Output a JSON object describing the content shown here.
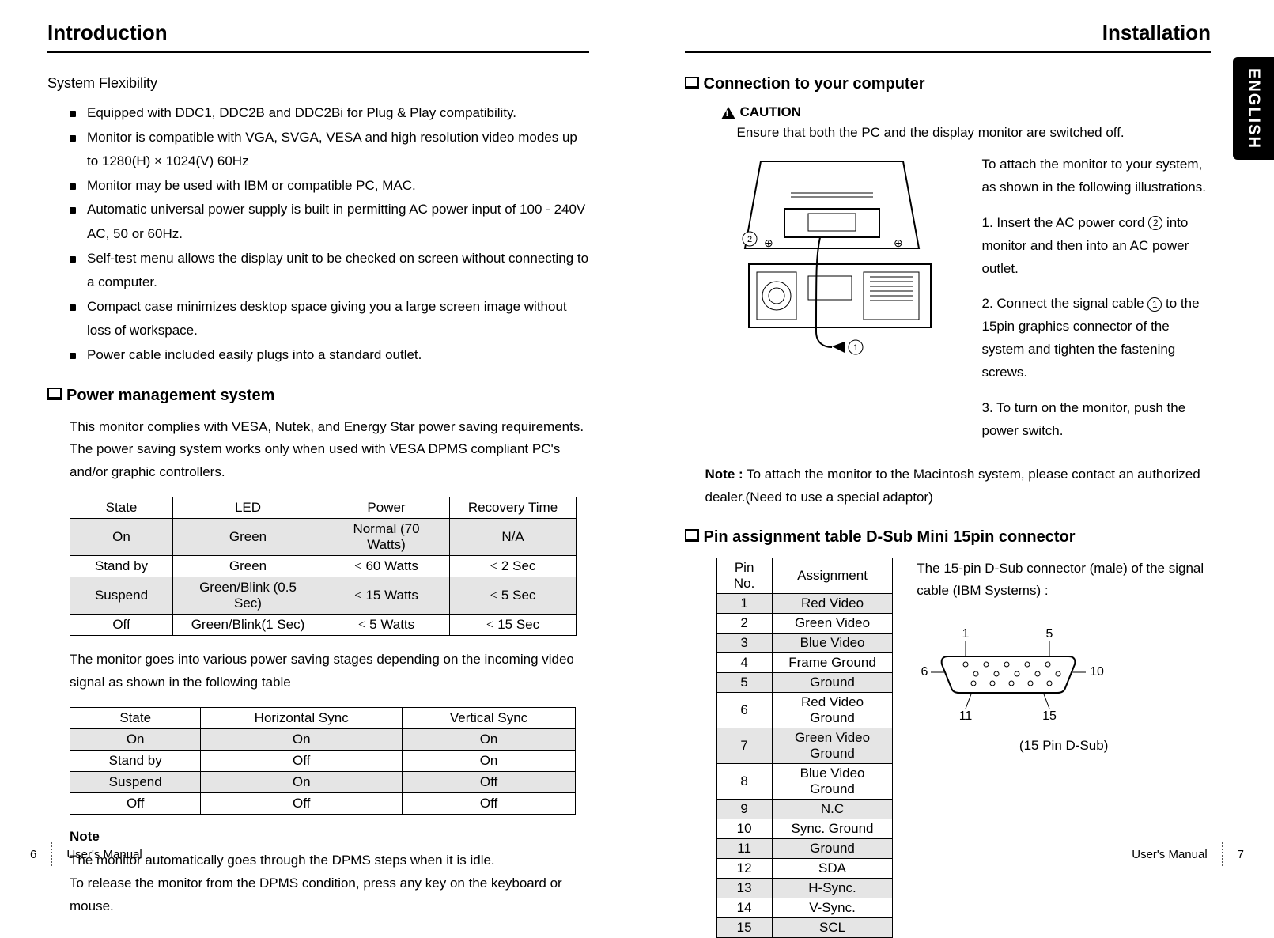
{
  "left": {
    "title": "Introduction",
    "sys_flex_heading": "System Flexibility",
    "flex_items": [
      "Equipped with DDC1, DDC2B and DDC2Bi for Plug & Play compatibility.",
      "Monitor is compatible with VGA, SVGA, VESA and high resolution video modes up to 1280(H) × 1024(V) 60Hz",
      "Monitor may be used with IBM or compatible PC, MAC.",
      "Automatic universal power supply is built in permitting AC power input of 100 - 240V AC, 50 or 60Hz.",
      "Self-test menu allows the display unit to be checked on screen without connecting to a computer.",
      "Compact case minimizes desktop space giving you a large screen image without loss of workspace.",
      "Power cable included easily plugs into a standard outlet."
    ],
    "pm_heading": "Power management system",
    "pm_intro": "This monitor complies with VESA, Nutek, and Energy Star power saving requirements. The power saving system works only when used with VESA DPMS compliant PC's and/or graphic controllers.",
    "t1_headers": [
      "State",
      "LED",
      "Power",
      "Recovery Time"
    ],
    "t1_rows": [
      [
        "On",
        "Green",
        "Normal (70 Watts)",
        "N/A"
      ],
      [
        "Stand by",
        "Green",
        "< 60 Watts",
        "< 2 Sec"
      ],
      [
        "Suspend",
        "Green/Blink (0.5 Sec)",
        "< 15 Watts",
        "< 5 Sec"
      ],
      [
        "Off",
        "Green/Blink(1 Sec)",
        "< 5 Watts",
        "< 15 Sec"
      ]
    ],
    "pm_mid": "The monitor goes into various power saving stages depending on the incoming video signal as shown in the following table",
    "t2_headers": [
      "State",
      "Horizontal Sync",
      "Vertical Sync"
    ],
    "t2_rows": [
      [
        "On",
        "On",
        "On"
      ],
      [
        "Stand by",
        "Off",
        "On"
      ],
      [
        "Suspend",
        "On",
        "Off"
      ],
      [
        "Off",
        "Off",
        "Off"
      ]
    ],
    "note_heading": "Note",
    "note_body1": "The monitor automatically goes through the DPMS steps when it is idle.",
    "note_body2": "To release the monitor from the DPMS condition, press any key on the keyboard or mouse.",
    "footer_page": "6",
    "footer_label": "User's Manual"
  },
  "right": {
    "title": "Installation",
    "tab": "ENGLISH",
    "conn_heading": "Connection to your computer",
    "caution_label": "CAUTION",
    "caution_text": "Ensure that both the PC and the display monitor are switched off.",
    "conn_intro": "To attach the monitor to your system, as shown in the following illustrations.",
    "step1_a": "1. Insert the AC power cord ",
    "step1_b": " into monitor and then into an AC power outlet.",
    "step2_a": "2. Connect the signal cable ",
    "step2_b": " to the 15pin graphics connector of the system and tighten the fastening screws.",
    "step3": "3. To turn on the monitor, push the power switch.",
    "note_attach": "Note : To attach the monitor to the Macintosh system, please contact an authorized dealer.(Need to use a special adaptor)",
    "pin_heading": "Pin assignment table D-Sub Mini 15pin connector",
    "pin_headers": [
      "Pin No.",
      "Assignment"
    ],
    "pin_rows": [
      [
        "1",
        "Red Video"
      ],
      [
        "2",
        "Green Video"
      ],
      [
        "3",
        "Blue Video"
      ],
      [
        "4",
        "Frame Ground"
      ],
      [
        "5",
        "Ground"
      ],
      [
        "6",
        "Red Video Ground"
      ],
      [
        "7",
        "Green Video Ground"
      ],
      [
        "8",
        "Blue Video Ground"
      ],
      [
        "9",
        "N.C"
      ],
      [
        "10",
        "Sync. Ground"
      ],
      [
        "11",
        "Ground"
      ],
      [
        "12",
        "SDA"
      ],
      [
        "13",
        "H-Sync."
      ],
      [
        "14",
        "V-Sync."
      ],
      [
        "15",
        "SCL"
      ]
    ],
    "dsub_caption": "The 15-pin D-Sub connector (male) of the signal cable (IBM Systems) :",
    "dsub_labels": {
      "tl": "1",
      "tr": "5",
      "ml": "6",
      "mr": "10",
      "bl": "11",
      "br": "15"
    },
    "dsub_footer": "(15 Pin D-Sub)",
    "footer_label": "User's Manual",
    "footer_page": "7"
  }
}
